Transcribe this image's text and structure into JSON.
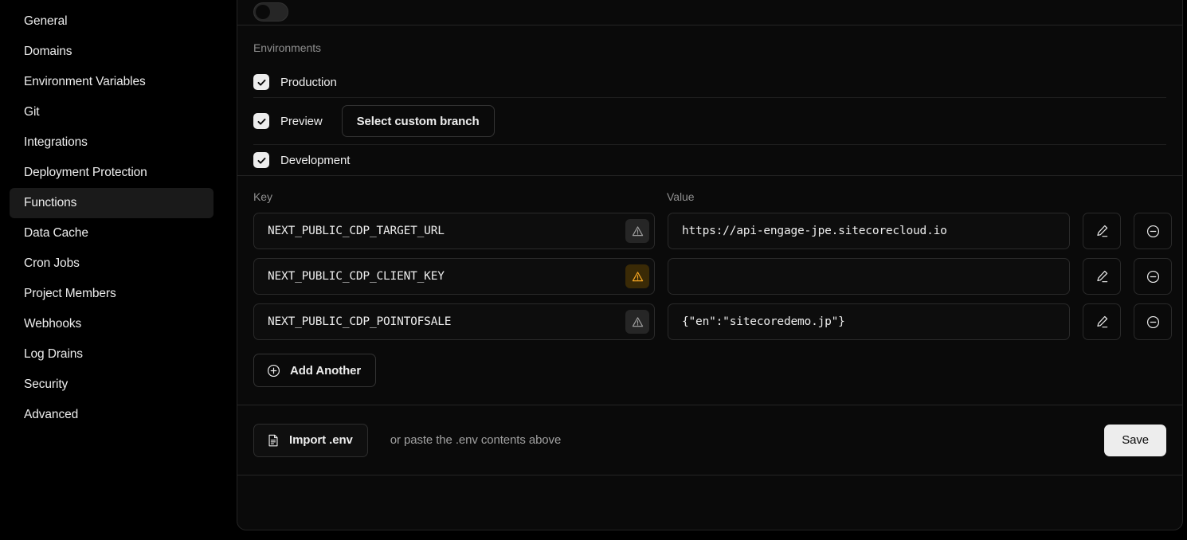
{
  "sidebar": {
    "items": [
      {
        "label": "General",
        "active": false
      },
      {
        "label": "Domains",
        "active": false
      },
      {
        "label": "Environment Variables",
        "active": false
      },
      {
        "label": "Git",
        "active": false
      },
      {
        "label": "Integrations",
        "active": false
      },
      {
        "label": "Deployment Protection",
        "active": false
      },
      {
        "label": "Functions",
        "active": true
      },
      {
        "label": "Data Cache",
        "active": false
      },
      {
        "label": "Cron Jobs",
        "active": false
      },
      {
        "label": "Project Members",
        "active": false
      },
      {
        "label": "Webhooks",
        "active": false
      },
      {
        "label": "Log Drains",
        "active": false
      },
      {
        "label": "Security",
        "active": false
      },
      {
        "label": "Advanced",
        "active": false
      }
    ]
  },
  "environments": {
    "section_label": "Environments",
    "items": [
      {
        "label": "Production",
        "checked": true,
        "has_branch_button": false
      },
      {
        "label": "Preview",
        "checked": true,
        "has_branch_button": true
      },
      {
        "label": "Development",
        "checked": true,
        "has_branch_button": false
      }
    ],
    "branch_button_label": "Select custom branch"
  },
  "variables_table": {
    "key_column_header": "Key",
    "value_column_header": "Value",
    "rows": [
      {
        "key": "NEXT_PUBLIC_CDP_TARGET_URL",
        "value": "https://api-engage-jpe.sitecorecloud.io",
        "warning_level": "neutral"
      },
      {
        "key": "NEXT_PUBLIC_CDP_CLIENT_KEY",
        "value": "",
        "warning_level": "amber"
      },
      {
        "key": "NEXT_PUBLIC_CDP_POINTOFSALE",
        "value": "{\"en\":\"sitecoredemo.jp\"}",
        "warning_level": "neutral"
      }
    ],
    "add_another_label": "Add Another"
  },
  "footer": {
    "import_label": "Import .env",
    "paste_hint": "or paste the .env contents above",
    "save_label": "Save"
  },
  "colors": {
    "background": "#000000",
    "panel_background": "#0a0a0a",
    "border": "#242424",
    "text_primary": "#ededed",
    "text_muted": "#8f8f8f",
    "warning_amber": "#f5a623",
    "accent_light": "#ededed"
  }
}
